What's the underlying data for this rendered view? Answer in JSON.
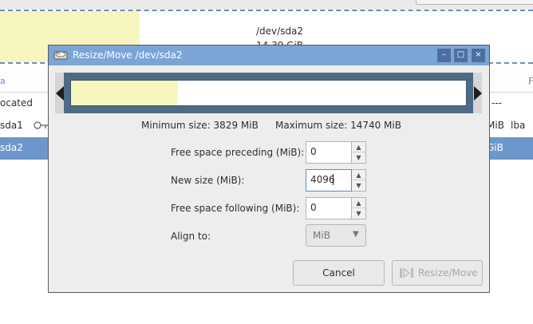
{
  "background": {
    "partition_map": {
      "name": "/dev/sda2",
      "size": "14.39 GiB"
    },
    "list": {
      "header_left": "a",
      "header_right": "F",
      "rows": [
        {
          "col1": "ocated",
          "col2": "---",
          "col3": ""
        },
        {
          "col1": "sda1",
          "col2": "MiB",
          "col3": "lba"
        },
        {
          "col1": "sda2",
          "col2": "GiB",
          "col3": ""
        }
      ]
    }
  },
  "dialog": {
    "title": "Resize/Move /dev/sda2",
    "window_buttons": {
      "minimize": "–",
      "maximize": "□",
      "close": "×"
    },
    "used_fraction": 0.27,
    "min_size": "Minimum size: 3829 MiB",
    "max_size": "Maximum size: 14740 MiB",
    "fields": {
      "free_preceding": {
        "label": "Free space preceding (MiB):",
        "value": "0"
      },
      "new_size": {
        "label": "New size (MiB):",
        "value": "4096"
      },
      "free_following": {
        "label": "Free space following (MiB):",
        "value": "0"
      },
      "align": {
        "label": "Align to:",
        "value": "MiB"
      }
    },
    "buttons": {
      "cancel": "Cancel",
      "resize_move": "Resize/Move"
    },
    "colors": {
      "titlebar": "#7ba4d7",
      "used_space": "#f8f6bf",
      "partition_border": "#4d6b85",
      "selected_row": "#6d97cc"
    }
  }
}
